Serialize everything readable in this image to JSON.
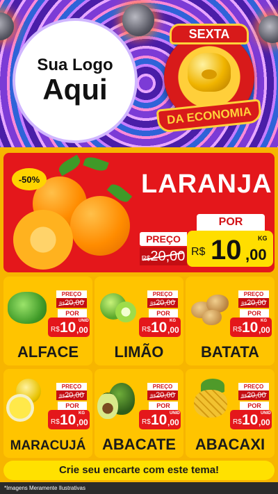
{
  "header": {
    "logo_line1": "Sua Logo",
    "logo_line2": "Aqui",
    "badge_top": "SEXTA",
    "badge_bottom": "DA ECONOMIA"
  },
  "hero": {
    "discount": "-50%",
    "title": "LARANJA",
    "preco_label": "PREÇO",
    "old_currency": "R$",
    "old_price": "20,00",
    "por_label": "POR",
    "currency": "R$",
    "price_int": "10",
    "price_dec": ",00",
    "unit": "KG"
  },
  "products": [
    {
      "name": "ALFACE",
      "preco_label": "PREÇO",
      "old_currency": "R$",
      "old_price": "20,00",
      "por_label": "POR",
      "currency": "R$",
      "price_int": "10",
      "price_dec": ",00",
      "unit": "UNID"
    },
    {
      "name": "LIMÃO",
      "preco_label": "PREÇO",
      "old_currency": "R$",
      "old_price": "20,00",
      "por_label": "POR",
      "currency": "R$",
      "price_int": "10",
      "price_dec": ",00",
      "unit": "KG"
    },
    {
      "name": "BATATA",
      "preco_label": "PREÇO",
      "old_currency": "R$",
      "old_price": "20,00",
      "por_label": "POR",
      "currency": "R$",
      "price_int": "10",
      "price_dec": ",00",
      "unit": "KG"
    },
    {
      "name": "MARACUJÁ",
      "preco_label": "PREÇO",
      "old_currency": "R$",
      "old_price": "20,00",
      "por_label": "POR",
      "currency": "R$",
      "price_int": "10",
      "price_dec": ",00",
      "unit": "KG"
    },
    {
      "name": "ABACATE",
      "preco_label": "PREÇO",
      "old_currency": "R$",
      "old_price": "20,00",
      "por_label": "POR",
      "currency": "R$",
      "price_int": "10",
      "price_dec": ",00",
      "unit": "UNID"
    },
    {
      "name": "ABACAXI",
      "preco_label": "PREÇO",
      "old_currency": "R$",
      "old_price": "20,00",
      "por_label": "POR",
      "currency": "R$",
      "price_int": "10",
      "price_dec": ",00",
      "unit": "UNID"
    }
  ],
  "footer": {
    "cta": "Crie seu encarte com este tema!",
    "disclaimer": "*Imagens Meramente Ilustrativas"
  },
  "colors": {
    "background": "#f7b500",
    "hero_red": "#e4171b",
    "card_yellow": "#ffc400",
    "price_yellow": "#ffde00"
  }
}
